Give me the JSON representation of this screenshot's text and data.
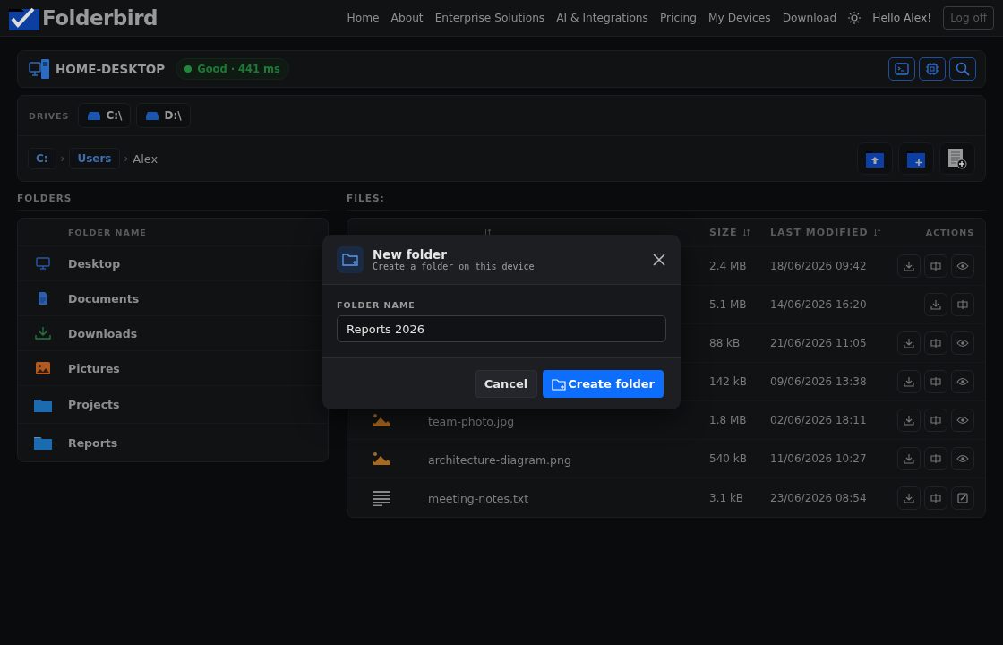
{
  "navbar": {
    "brand": "Folderbird",
    "links": [
      {
        "label": "Home"
      },
      {
        "label": "About"
      },
      {
        "label": "Enterprise Solutions"
      },
      {
        "label": "AI & Integrations"
      },
      {
        "label": "Pricing"
      },
      {
        "label": "My Devices"
      },
      {
        "label": "Download"
      }
    ],
    "greeting": "Hello Alex!",
    "logout": "Log off"
  },
  "device": {
    "name": "HOME-DESKTOP",
    "status": "Good · 441 ms",
    "tools": [
      {
        "kind": "terminal"
      },
      {
        "kind": "chip"
      },
      {
        "kind": "search"
      }
    ]
  },
  "drives": {
    "label": "DRIVES",
    "items": [
      {
        "label": "C:\\"
      },
      {
        "label": "D:\\"
      }
    ]
  },
  "breadcrumb": [
    {
      "label": "C:",
      "kind": "chip"
    },
    {
      "label": "›",
      "kind": "separator"
    },
    {
      "label": "Users",
      "kind": "chip"
    },
    {
      "label": "›",
      "kind": "separator"
    },
    {
      "label": "Alex",
      "kind": "current"
    }
  ],
  "path_actions": [
    {
      "kind": "upload-folder"
    },
    {
      "kind": "new-folder"
    },
    {
      "kind": "new-file"
    }
  ],
  "folders": {
    "title": "FOLDERS",
    "column": "FOLDER NAME",
    "items": [
      {
        "name": "Desktop",
        "kind": "desktop"
      },
      {
        "name": "Documents",
        "kind": "document"
      },
      {
        "name": "Downloads",
        "kind": "download"
      },
      {
        "name": "Pictures",
        "kind": "picture"
      },
      {
        "name": "Projects",
        "kind": "folder"
      },
      {
        "name": "Reports",
        "kind": "folder"
      }
    ]
  },
  "files": {
    "title": "FILES:",
    "columns": [
      {
        "sortable": true
      },
      {
        "label": "SIZE",
        "sortable": true
      },
      {
        "label": "LAST MODIFIED",
        "sortable": true
      },
      {
        "label": "ACTIONS",
        "sortable": false
      }
    ],
    "rows": [
      {
        "size": "2.4 MB",
        "modified": "18/06/2026 09:42",
        "actions": [
          {
            "kind": "download"
          },
          {
            "kind": "share"
          },
          {
            "kind": "view"
          }
        ]
      },
      {
        "size": "5.1 MB",
        "modified": "14/06/2026 16:20",
        "actions": [
          {
            "kind": "download"
          },
          {
            "kind": "share"
          }
        ]
      },
      {
        "size": "88 kB",
        "modified": "21/06/2026 11:05",
        "actions": [
          {
            "kind": "download"
          },
          {
            "kind": "share"
          },
          {
            "kind": "view"
          }
        ]
      },
      {
        "size": "142 kB",
        "modified": "09/06/2026 13:38",
        "actions": [
          {
            "kind": "download"
          },
          {
            "kind": "share"
          },
          {
            "kind": "view"
          }
        ]
      },
      {
        "name": "team-photo.jpg",
        "kind": "image",
        "size": "1.8 MB",
        "modified": "02/06/2026 18:11",
        "actions": [
          {
            "kind": "download"
          },
          {
            "kind": "share"
          },
          {
            "kind": "view"
          }
        ]
      },
      {
        "name": "architecture-diagram.png",
        "kind": "image",
        "size": "540 kB",
        "modified": "11/06/2026 10:27",
        "actions": [
          {
            "kind": "download"
          },
          {
            "kind": "share"
          },
          {
            "kind": "view"
          }
        ]
      },
      {
        "name": "meeting-notes.txt",
        "kind": "text",
        "size": "3.1 kB",
        "modified": "23/06/2026 08:54",
        "actions": [
          {
            "kind": "download"
          },
          {
            "kind": "share"
          },
          {
            "kind": "edit"
          }
        ]
      }
    ]
  },
  "dialog": {
    "title": "New folder",
    "subtitle": "Create a folder on this device",
    "field_label": "FOLDER NAME",
    "value": "Reports 2026",
    "buttons": [
      {
        "label": "Cancel",
        "kind": "secondary"
      },
      {
        "label": "Create folder",
        "kind": "primary"
      }
    ]
  }
}
